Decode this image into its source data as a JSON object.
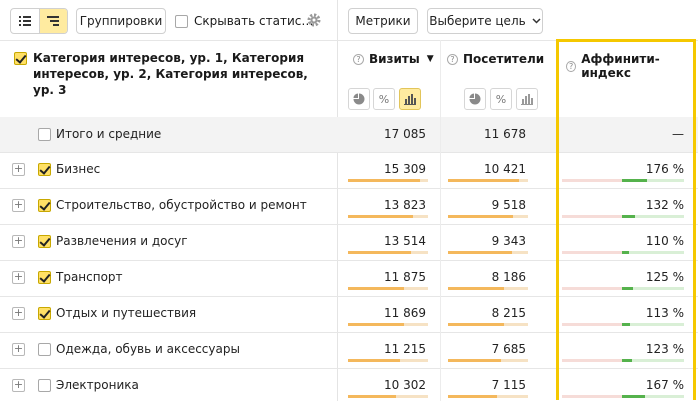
{
  "toolbar": {
    "group_label": "Группировки",
    "hide_stats_label": "Скрывать статис…",
    "metrics_label": "Метрики",
    "goal_label": "Выберите цель",
    "icons": [
      "list-view-icon",
      "tree-view-icon",
      "gear-icon",
      "chevron-down-icon"
    ]
  },
  "header": {
    "category": "Категория интересов, ур. 1, Категория интересов, ур. 2, Категория интересов, ур. 3",
    "visits": "Визиты",
    "visitors": "Посетители",
    "affinity": "Аффинити-индекс",
    "sort_arrow": "▼"
  },
  "totals": {
    "label": "Итого и средние",
    "visits": "17 085",
    "visitors": "11 678",
    "affinity": "—"
  },
  "rows": [
    {
      "label": "Бизнес",
      "checked": true,
      "visits": "15 309",
      "visits_frac": 0.896,
      "visitors": "10 421",
      "visitors_frac": 0.892,
      "affinity": "176 %",
      "aff_val": 176
    },
    {
      "label": "Строительство, обустройство и ремонт",
      "checked": true,
      "visits": "13 823",
      "visits_frac": 0.809,
      "visitors": "9 518",
      "visitors_frac": 0.815,
      "affinity": "132 %",
      "aff_val": 132
    },
    {
      "label": "Развлечения и досуг",
      "checked": true,
      "visits": "13 514",
      "visits_frac": 0.791,
      "visitors": "9 343",
      "visitors_frac": 0.8,
      "affinity": "110 %",
      "aff_val": 110
    },
    {
      "label": "Транспорт",
      "checked": true,
      "visits": "11 875",
      "visits_frac": 0.695,
      "visitors": "8 186",
      "visitors_frac": 0.701,
      "affinity": "125 %",
      "aff_val": 125
    },
    {
      "label": "Отдых и путешествия",
      "checked": true,
      "visits": "11 869",
      "visits_frac": 0.695,
      "visitors": "8 215",
      "visitors_frac": 0.703,
      "affinity": "113 %",
      "aff_val": 113
    },
    {
      "label": "Одежда, обувь и аксессуары",
      "checked": false,
      "visits": "11 215",
      "visits_frac": 0.656,
      "visitors": "7 685",
      "visitors_frac": 0.658,
      "affinity": "123 %",
      "aff_val": 123
    },
    {
      "label": "Электроника",
      "checked": false,
      "visits": "10 302",
      "visits_frac": 0.603,
      "visitors": "7 115",
      "visitors_frac": 0.609,
      "affinity": "167 %",
      "aff_val": 167
    }
  ],
  "colors": {
    "accent": "#ffeba0",
    "highlight": "#f5c800",
    "bar": "#f4b85c",
    "affinity_positive": "#55b24c"
  }
}
